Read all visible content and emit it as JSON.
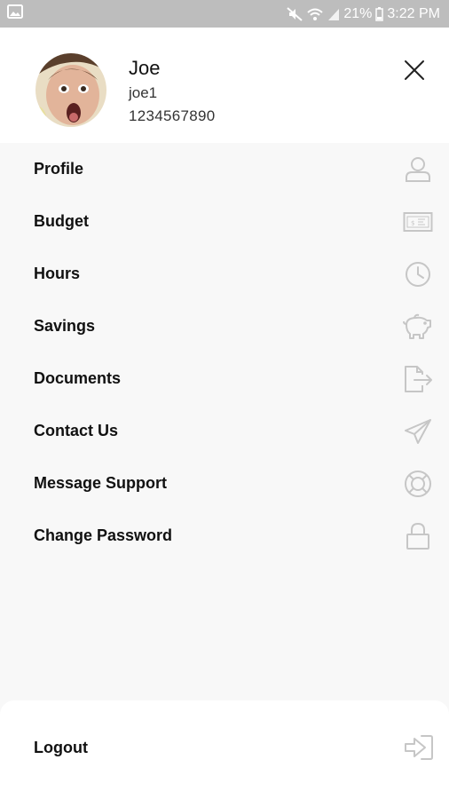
{
  "status_bar": {
    "battery": "21%",
    "time": "3:22 PM"
  },
  "user": {
    "name": "Joe",
    "username": "joe1",
    "phone": "1234567890"
  },
  "menu": {
    "items": [
      {
        "label": "Profile",
        "icon": "person-icon"
      },
      {
        "label": "Budget",
        "icon": "money-bill-icon"
      },
      {
        "label": "Hours",
        "icon": "clock-icon"
      },
      {
        "label": "Savings",
        "icon": "piggy-bank-icon"
      },
      {
        "label": "Documents",
        "icon": "document-export-icon"
      },
      {
        "label": "Contact Us",
        "icon": "paper-plane-icon"
      },
      {
        "label": "Message Support",
        "icon": "lifebuoy-icon"
      },
      {
        "label": "Change Password",
        "icon": "lock-icon"
      }
    ]
  },
  "logout": {
    "label": "Logout",
    "icon": "sign-in-icon"
  },
  "colors": {
    "status_bar": "#bdbdbd",
    "menu_background": "#f8f8f8",
    "panel_background": "#ffffff",
    "icon": "#c6c6c6",
    "text": "#111111"
  }
}
